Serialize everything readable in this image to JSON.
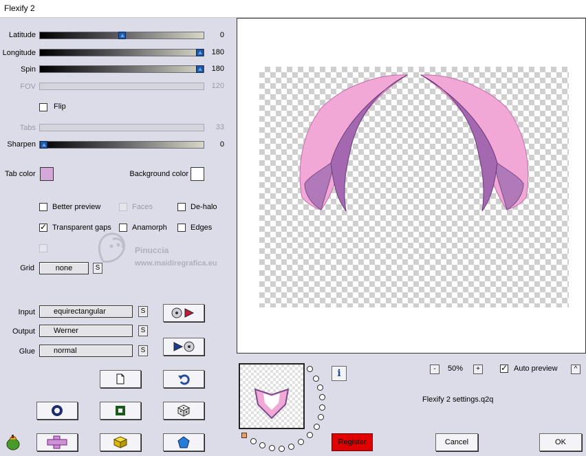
{
  "window": {
    "title": "Flexify 2"
  },
  "sliders": [
    {
      "label": "Latitude",
      "value": "0",
      "fraction": 0.5,
      "enabled": true
    },
    {
      "label": "Longitude",
      "value": "180",
      "fraction": 1.0,
      "enabled": true
    },
    {
      "label": "Spin",
      "value": "180",
      "fraction": 1.0,
      "enabled": true
    },
    {
      "label": "FOV",
      "value": "120",
      "enabled": false
    },
    {
      "label": "Tabs",
      "value": "33",
      "enabled": false
    },
    {
      "label": "Sharpen",
      "value": "0",
      "fraction": 0.0,
      "enabled": true
    }
  ],
  "flip": {
    "label": "Flip",
    "checked": false
  },
  "tab_color": {
    "label": "Tab color",
    "color": "#d4a8d8"
  },
  "background_color": {
    "label": "Background color",
    "color": "#ffffff"
  },
  "options": {
    "better_preview": {
      "label": "Better preview",
      "checked": false
    },
    "faces": {
      "label": "Faces",
      "checked": false,
      "enabled": false
    },
    "de_halo": {
      "label": "De-halo",
      "checked": false
    },
    "transparent_gaps": {
      "label": "Transparent gaps",
      "checked": true
    },
    "anamorph": {
      "label": "Anamorph",
      "checked": false
    },
    "edges": {
      "label": "Edges",
      "checked": false
    }
  },
  "grid": {
    "label": "Grid",
    "value": "none",
    "s_label": "S"
  },
  "input": {
    "label": "Input",
    "value": "equirectangular",
    "s_label": "S"
  },
  "output": {
    "label": "Output",
    "value": "Werner",
    "s_label": "S"
  },
  "glue": {
    "label": "Glue",
    "value": "normal",
    "s_label": "S"
  },
  "watermark": {
    "name": "Pinuccia",
    "url": "www.maidiregrafica.eu"
  },
  "zoom": {
    "minus": "-",
    "value": "50%",
    "plus": "+"
  },
  "auto_preview": {
    "label": "Auto preview",
    "checked": true,
    "up": "^"
  },
  "settings_file": "Flexify 2 settings.q2q",
  "buttons": {
    "register": "Register",
    "cancel": "Cancel",
    "ok": "OK",
    "info": "i"
  },
  "colors": {
    "accent_pink": "#f2a8d6",
    "accent_purple": "#b07ab8",
    "register_red": "#e00000"
  }
}
